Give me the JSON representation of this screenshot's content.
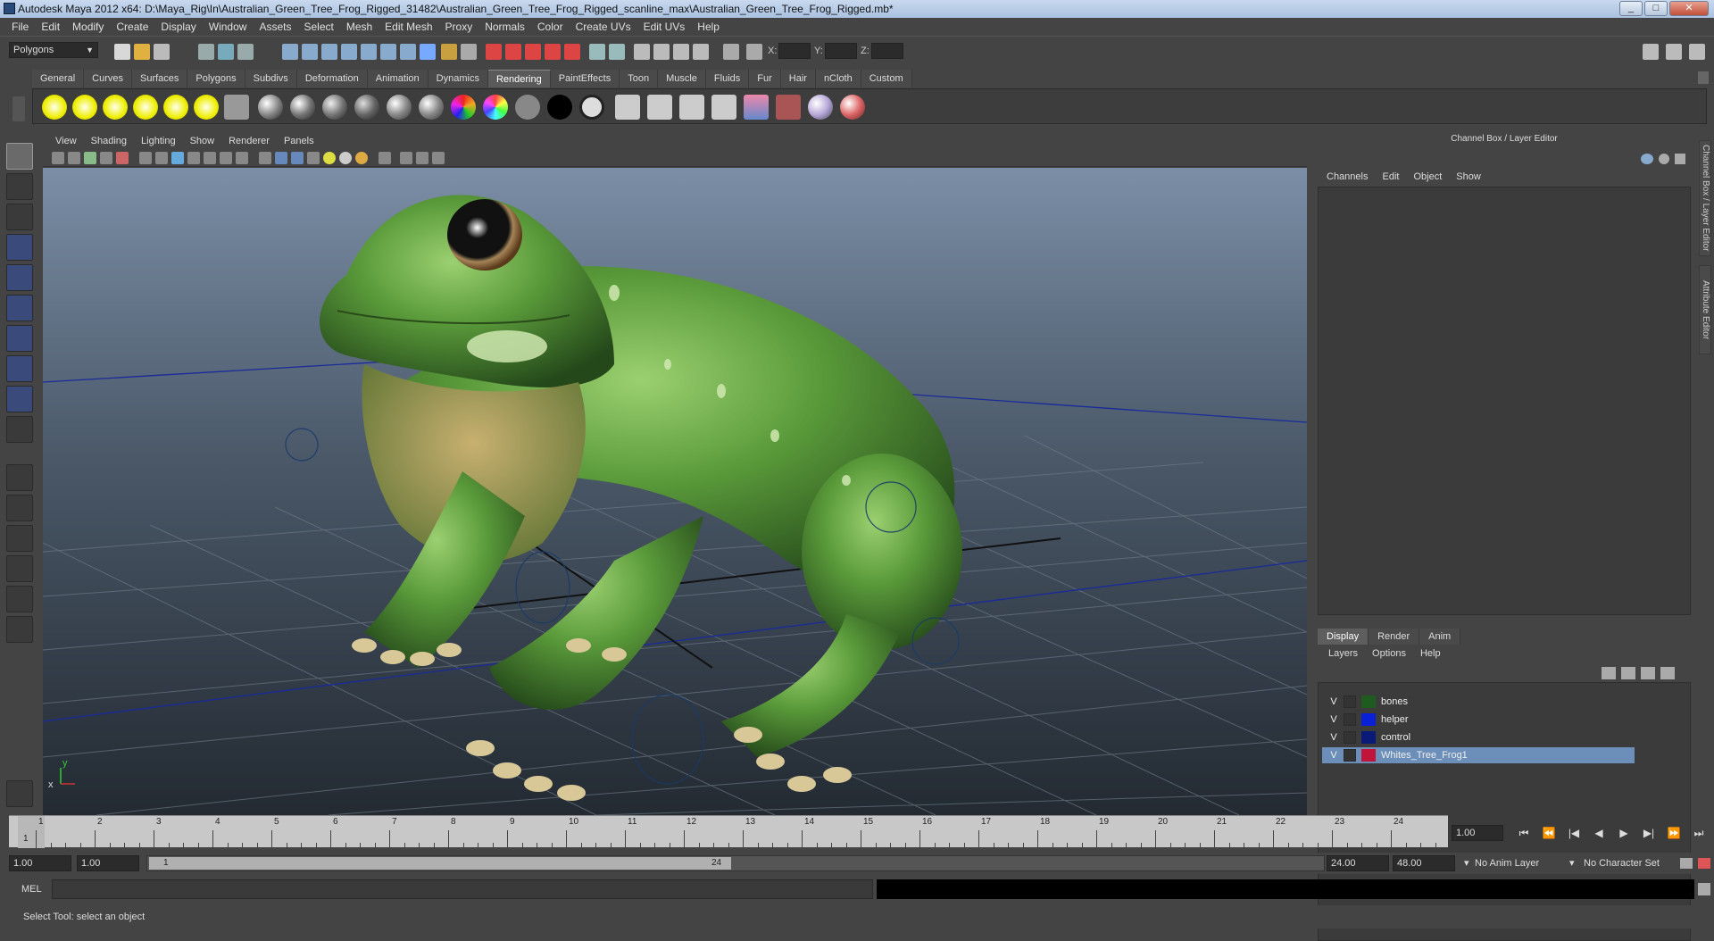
{
  "window": {
    "title": "Autodesk Maya 2012 x64: D:\\Maya_Rig\\In\\Australian_Green_Tree_Frog_Rigged_31482\\Australian_Green_Tree_Frog_Rigged_scanline_max\\Australian_Green_Tree_Frog_Rigged.mb*"
  },
  "menubar": {
    "items": [
      "File",
      "Edit",
      "Modify",
      "Create",
      "Display",
      "Window",
      "Assets",
      "Select",
      "Mesh",
      "Edit Mesh",
      "Proxy",
      "Normals",
      "Color",
      "Create UVs",
      "Edit UVs",
      "Help"
    ]
  },
  "statusline": {
    "mode": "Polygons",
    "x_label": "X:",
    "y_label": "Y:",
    "z_label": "Z:"
  },
  "shelf": {
    "tabs": [
      "General",
      "Curves",
      "Surfaces",
      "Polygons",
      "Subdivs",
      "Deformation",
      "Animation",
      "Dynamics",
      "Rendering",
      "PaintEffects",
      "Toon",
      "Muscle",
      "Fluids",
      "Fur",
      "Hair",
      "nCloth",
      "Custom"
    ],
    "active_tab": "Rendering"
  },
  "viewport": {
    "menus": [
      "View",
      "Shading",
      "Lighting",
      "Show",
      "Renderer",
      "Panels"
    ],
    "axis_x": "x",
    "axis_y": "y",
    "bg_top": "#7b8ea6",
    "bg_bottom": "#232a32",
    "frog_color": "#5a9a3a"
  },
  "channel_box": {
    "title": "Channel Box / Layer Editor",
    "menus": [
      "Channels",
      "Edit",
      "Object",
      "Show"
    ]
  },
  "layer_editor": {
    "tabs": [
      "Display",
      "Render",
      "Anim"
    ],
    "active_tab": "Display",
    "menus": [
      "Layers",
      "Options",
      "Help"
    ],
    "layers": [
      {
        "v": "V",
        "name": "bones",
        "color": "#1f5a1f",
        "selected": false
      },
      {
        "v": "V",
        "name": "helper",
        "color": "#0a1fd8",
        "selected": false
      },
      {
        "v": "V",
        "name": "control",
        "color": "#0a1a78",
        "selected": false
      },
      {
        "v": "V",
        "name": "Whites_Tree_Frog1",
        "color": "#c0143a",
        "selected": true
      }
    ]
  },
  "side_tabs": [
    "Channel Box / Layer Editor",
    "Attribute Editor"
  ],
  "timeline": {
    "ticks": [
      "1",
      "2",
      "3",
      "4",
      "5",
      "6",
      "7",
      "8",
      "9",
      "10",
      "11",
      "12",
      "13",
      "14",
      "15",
      "16",
      "17",
      "18",
      "19",
      "20",
      "21",
      "22",
      "23",
      "24"
    ],
    "current_marker": "1",
    "current_frame": "1.00"
  },
  "range": {
    "start": "1.00",
    "playback_start": "1.00",
    "slider_start": "1",
    "slider_end": "24",
    "playback_end": "24.00",
    "end": "48.00",
    "anim_layer": "No Anim Layer",
    "char_set": "No Character Set"
  },
  "command": {
    "label": "MEL"
  },
  "help": {
    "text": "Select Tool: select an object"
  }
}
